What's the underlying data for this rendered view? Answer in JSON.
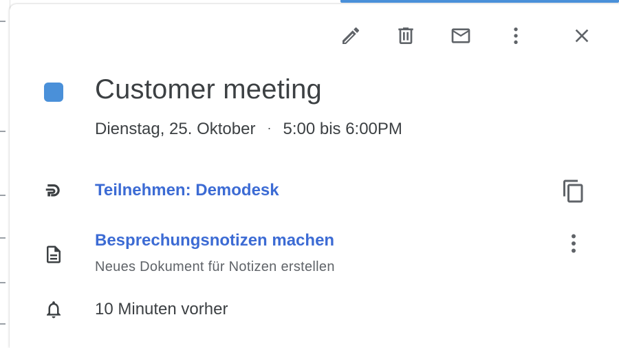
{
  "colors": {
    "event_color": "#4a90d9",
    "link_color": "#3c6bd4",
    "icon_color": "#5f6368"
  },
  "toolbar": {
    "edit_icon": "pencil-icon",
    "delete_icon": "trash-icon",
    "email_icon": "mail-icon",
    "more_icon": "more-vertical-icon",
    "close_icon": "close-icon"
  },
  "event": {
    "title": "Customer meeting",
    "date": "Dienstag, 25. Oktober",
    "separator": "·",
    "time": "5:00 bis 6:00PM"
  },
  "conference": {
    "icon": "demodesk-logo-icon",
    "label": "Teilnehmen: Demodesk",
    "copy_icon": "copy-icon"
  },
  "notes": {
    "icon": "document-icon",
    "label": "Besprechungsnotizen machen",
    "sublabel": "Neues Dokument für Notizen erstellen",
    "more_icon": "more-vertical-icon"
  },
  "reminder": {
    "icon": "bell-icon",
    "label": "10 Minuten vorher"
  }
}
